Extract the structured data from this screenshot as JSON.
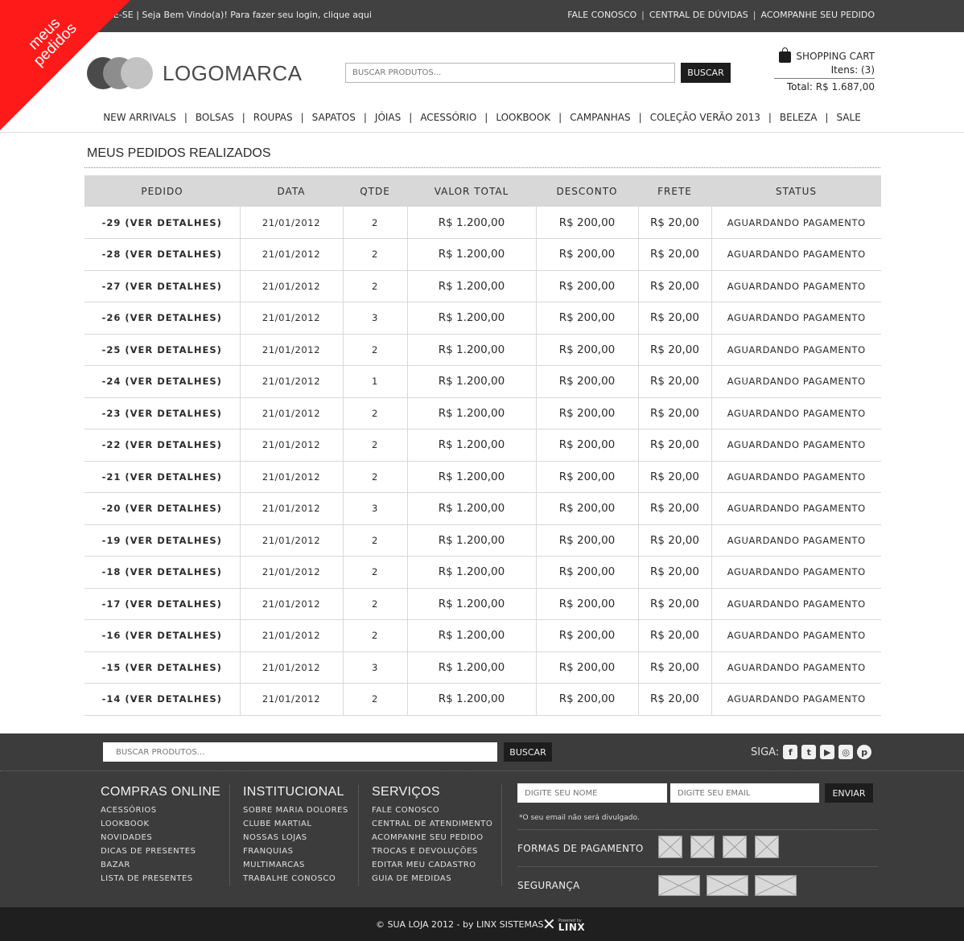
{
  "ribbon": {
    "line1": "meus",
    "line2": "pedidos"
  },
  "topbar": {
    "welcome": "ASTRE-SE | Seja Bem Vindo(a)! Para fazer seu login, clique aqui",
    "links": [
      "FALE CONOSCO",
      "CENTRAL DE DÚVIDAS",
      "ACOMPANHE SEU PEDIDO"
    ],
    "separator": "|"
  },
  "header": {
    "logo_text": "LOGOMARCA",
    "search_placeholder": "BUSCAR PRODUTOS...",
    "search_button": "BUSCAR"
  },
  "cart": {
    "title": "SHOPPING CART",
    "items_label": "Itens:",
    "items_value": "(3)",
    "total_label": "Total:",
    "total_value": "R$ 1.687,00"
  },
  "nav": {
    "items": [
      "NEW ARRIVALS",
      "BOLSAS",
      "ROUPAS",
      "SAPATOS",
      "JÓIAS",
      "ACESSÓRIO",
      "LOOKBOOK",
      "CAMPANHAS",
      "COLEÇÃO VERÃO 2013",
      "BELEZA",
      "SALE"
    ],
    "separator": "|"
  },
  "main": {
    "title": "MEUS PEDIDOS REALIZADOS",
    "columns": [
      "PEDIDO",
      "DATA",
      "QTDE",
      "VALOR TOTAL",
      "DESCONTO",
      "FRETE",
      "STATUS"
    ],
    "rows": [
      [
        "-29 (VER DETALHES)",
        "21/01/2012",
        "2",
        "R$ 1.200,00",
        "R$ 200,00",
        "R$ 20,00",
        "AGUARDANDO PAGAMENTO"
      ],
      [
        "-28 (VER DETALHES)",
        "21/01/2012",
        "2",
        "R$ 1.200,00",
        "R$ 200,00",
        "R$ 20,00",
        "AGUARDANDO PAGAMENTO"
      ],
      [
        "-27 (VER DETALHES)",
        "21/01/2012",
        "2",
        "R$ 1.200,00",
        "R$ 200,00",
        "R$ 20,00",
        "AGUARDANDO PAGAMENTO"
      ],
      [
        "-26 (VER DETALHES)",
        "21/01/2012",
        "3",
        "R$ 1.200,00",
        "R$ 200,00",
        "R$ 20,00",
        "AGUARDANDO PAGAMENTO"
      ],
      [
        "-25 (VER DETALHES)",
        "21/01/2012",
        "2",
        "R$ 1.200,00",
        "R$ 200,00",
        "R$ 20,00",
        "AGUARDANDO PAGAMENTO"
      ],
      [
        "-24 (VER DETALHES)",
        "21/01/2012",
        "1",
        "R$ 1.200,00",
        "R$ 200,00",
        "R$ 20,00",
        "AGUARDANDO PAGAMENTO"
      ],
      [
        "-23 (VER DETALHES)",
        "21/01/2012",
        "2",
        "R$ 1.200,00",
        "R$ 200,00",
        "R$ 20,00",
        "AGUARDANDO PAGAMENTO"
      ],
      [
        "-22 (VER DETALHES)",
        "21/01/2012",
        "2",
        "R$ 1.200,00",
        "R$ 200,00",
        "R$ 20,00",
        "AGUARDANDO PAGAMENTO"
      ],
      [
        "-21 (VER DETALHES)",
        "21/01/2012",
        "2",
        "R$ 1.200,00",
        "R$ 200,00",
        "R$ 20,00",
        "AGUARDANDO PAGAMENTO"
      ],
      [
        "-20 (VER DETALHES)",
        "21/01/2012",
        "3",
        "R$ 1.200,00",
        "R$ 200,00",
        "R$ 20,00",
        "AGUARDANDO PAGAMENTO"
      ],
      [
        "-19 (VER DETALHES)",
        "21/01/2012",
        "2",
        "R$ 1.200,00",
        "R$ 200,00",
        "R$ 20,00",
        "AGUARDANDO PAGAMENTO"
      ],
      [
        "-18 (VER DETALHES)",
        "21/01/2012",
        "2",
        "R$ 1.200,00",
        "R$ 200,00",
        "R$ 20,00",
        "AGUARDANDO PAGAMENTO"
      ],
      [
        "-17 (VER DETALHES)",
        "21/01/2012",
        "2",
        "R$ 1.200,00",
        "R$ 200,00",
        "R$ 20,00",
        "AGUARDANDO PAGAMENTO"
      ],
      [
        "-16 (VER DETALHES)",
        "21/01/2012",
        "2",
        "R$ 1.200,00",
        "R$ 200,00",
        "R$ 20,00",
        "AGUARDANDO PAGAMENTO"
      ],
      [
        "-15 (VER DETALHES)",
        "21/01/2012",
        "3",
        "R$ 1.200,00",
        "R$ 200,00",
        "R$ 20,00",
        "AGUARDANDO PAGAMENTO"
      ],
      [
        "-14 (VER DETALHES)",
        "21/01/2012",
        "2",
        "R$ 1.200,00",
        "R$ 200,00",
        "R$ 20,00",
        "AGUARDANDO PAGAMENTO"
      ]
    ]
  },
  "footer": {
    "search_placeholder": "BUSCAR PRODUTOS...",
    "search_button": "BUSCAR",
    "follow_label": "SIGA:",
    "social_icons": [
      "facebook-icon",
      "twitter-icon",
      "youtube-icon",
      "instagram-icon",
      "pinterest-icon"
    ],
    "columns": [
      {
        "title": "COMPRAS ONLINE",
        "items": [
          "ACESSÓRIOS",
          "LOOKBOOK",
          "NOVIDADES",
          "DICAS DE PRESENTES",
          "BAZAR",
          "LISTA DE PRESENTES"
        ]
      },
      {
        "title": "INSTITUCIONAL",
        "items": [
          "SOBRE MARIA DOLORES",
          "CLUBE MARTIAL",
          "NOSSAS LOJAS",
          "FRANQUIAS",
          "MULTIMARCAS",
          "TRABALHE CONOSCO"
        ]
      },
      {
        "title": "SERVIÇOS",
        "items": [
          "FALE CONOSCO",
          "CENTRAL DE ATENDIMENTO",
          "ACOMPANHE SEU PEDIDO",
          "TROCAS E DEVOLUÇÕES",
          "EDITAR MEU CADASTRO",
          "GUIA DE MEDIDAS"
        ]
      }
    ],
    "newsletter": {
      "name_placeholder": "DIGITE SEU NOME",
      "email_placeholder": "DIGITE SEU EMAIL",
      "button": "ENVIAR",
      "note": "*O seu email não será divulgado."
    },
    "payment_label": "FORMAS DE PAGAMENTO",
    "security_label": "SEGURANÇA"
  },
  "bottom": {
    "copyright": "© SUA LOJA 2012 - by LINX SISTEMAS",
    "powered_by": "Powered by",
    "linx": "LINX"
  }
}
